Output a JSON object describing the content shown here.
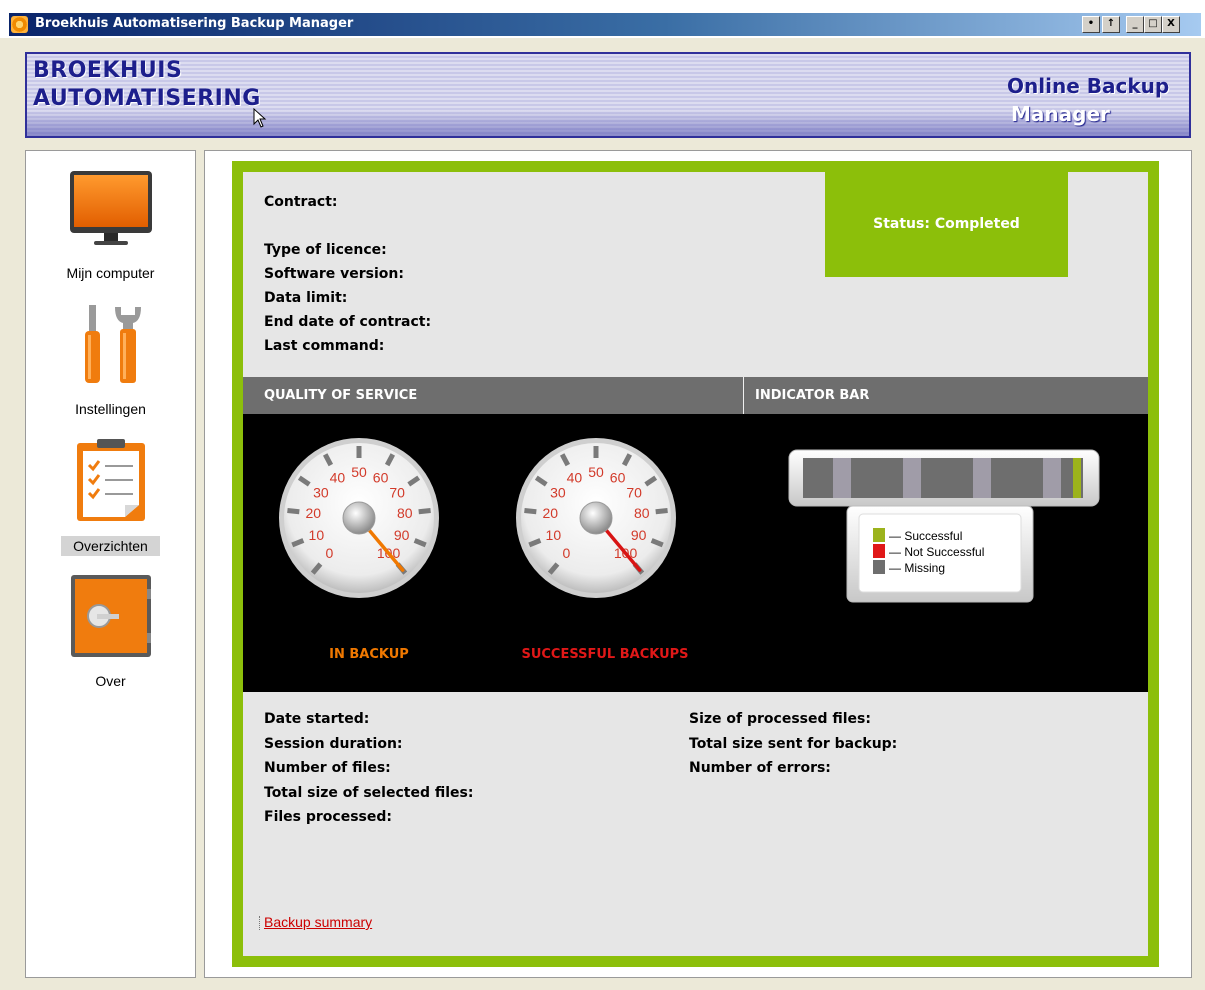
{
  "window": {
    "title": "Broekhuis Automatisering Backup Manager",
    "buttons": [
      "•",
      "↑",
      "_",
      "□",
      "X"
    ]
  },
  "header": {
    "brand_line1": "BROEKHUIS",
    "brand_line2": "AUTOMATISERING",
    "product_line1": "Online Backup",
    "product_line2": "Manager"
  },
  "sidebar": {
    "items": [
      {
        "label": "Mijn computer",
        "icon": "monitor-icon",
        "active": false
      },
      {
        "label": "Instellingen",
        "icon": "tools-icon",
        "active": false
      },
      {
        "label": "Overzichten",
        "icon": "checklist-icon",
        "active": true
      },
      {
        "label": "Over",
        "icon": "safe-icon",
        "active": false
      }
    ]
  },
  "info": {
    "contract": "Contract:",
    "type_of_licence": "Type of licence:",
    "software_version": "Software version:",
    "data_limit": "Data limit:",
    "end_date": "End date of contract:",
    "last_command": "Last command:"
  },
  "status": {
    "text": "Status: Completed",
    "color": "#8cbf0a"
  },
  "sections": {
    "quality": "QUALITY OF SERVICE",
    "indicator": "INDICATOR BAR"
  },
  "gauges": [
    {
      "label": "IN BACKUP",
      "value": 100,
      "needle_color": "#f07800",
      "label_color": "#f07800"
    },
    {
      "label": "SUCCESSFUL BACKUPS",
      "value": 100,
      "needle_color": "#d81414",
      "label_color": "#e01818"
    }
  ],
  "gauge_ticks": [
    "0",
    "10",
    "20",
    "30",
    "40",
    "50",
    "60",
    "70",
    "80",
    "90",
    "100"
  ],
  "legend": {
    "successful": "— Successful",
    "not_successful": "— Not Successful",
    "missing": "— Missing",
    "colors": {
      "successful": "#9cb31c",
      "not_successful": "#e01818",
      "missing": "#6e6e6e"
    }
  },
  "details_left": [
    "Date started:",
    "Session duration:",
    "Number of files:",
    "Total size of selected files:",
    "Files processed:"
  ],
  "details_right": [
    "Size of processed files:",
    "Total size sent for backup:",
    "Number of errors:"
  ],
  "link": {
    "backup_summary": "Backup summary"
  }
}
